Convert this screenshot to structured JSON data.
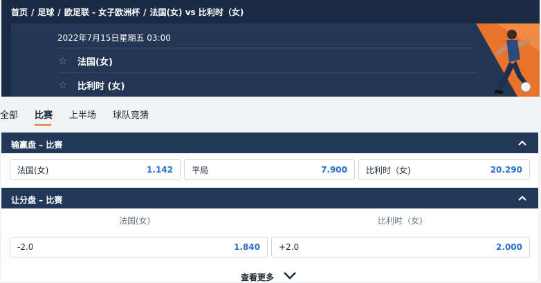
{
  "breadcrumb": [
    "首页",
    "足球",
    "欧足联 - 女子欧洲杯",
    "法国(女) vs 比利时（女)"
  ],
  "match": {
    "datetime": "2022年7月15日星期五 03:00",
    "team1": "法国(女)",
    "team2": "比利时 (女)"
  },
  "tabs": [
    "全部",
    "比赛",
    "上半场",
    "球队竞猜"
  ],
  "active_tab": "比赛",
  "moneyline": {
    "title": "输赢盘 – 比赛",
    "options": [
      {
        "label": "法国(女)",
        "odds": "1.142"
      },
      {
        "label": "平局",
        "odds": "7.900"
      },
      {
        "label": "比利时（女)",
        "odds": "20.290"
      }
    ]
  },
  "handicap": {
    "title": "让分盘 – 比赛",
    "team1": "法国(女)",
    "team2": "比利时（女)",
    "options": [
      {
        "label": "-2.0",
        "odds": "1.840"
      },
      {
        "label": "+2.0",
        "odds": "2.000"
      }
    ]
  },
  "see_more": "查看更多",
  "colors": {
    "header": "#1a2b45",
    "section": "#22395a",
    "accent": "#e8742c",
    "odds": "#2a6fcf"
  }
}
